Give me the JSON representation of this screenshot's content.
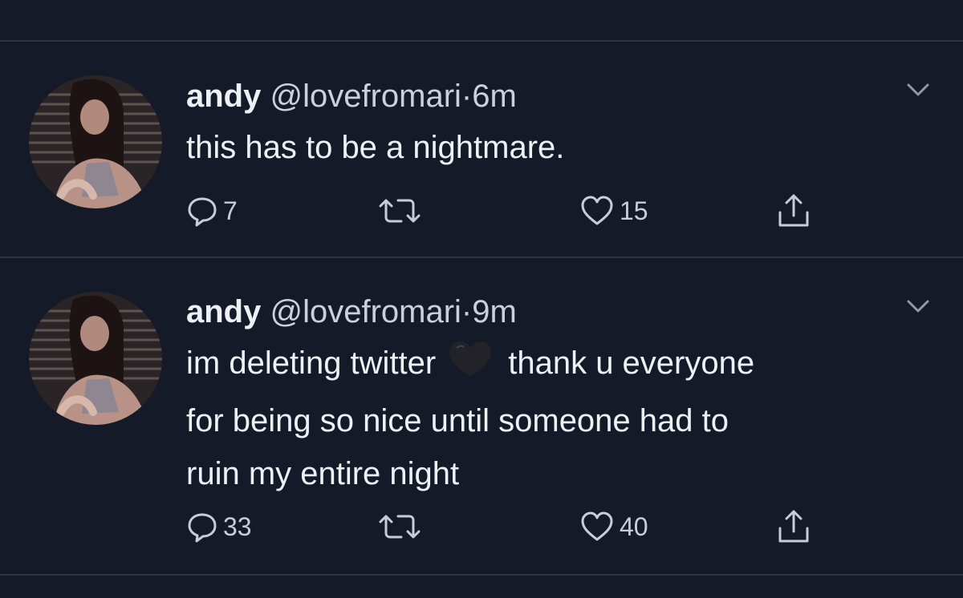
{
  "tweets": [
    {
      "name": "andy",
      "handle": "@lovefromari",
      "separator": "·",
      "time": "6m",
      "text": "this has to be a nightmare.",
      "replies": "7",
      "likes": "15"
    },
    {
      "name": "andy",
      "handle": "@lovefromari",
      "separator": "·",
      "time": "9m",
      "text_before_emoji": "im deleting twitter",
      "emoji": "black-heart",
      "text_after_emoji_line1": "thank u everyone",
      "text_line2": "for being so nice until someone had to",
      "text_line3": "ruin my entire night",
      "replies": "33",
      "likes": "40"
    }
  ],
  "icons": {
    "reply": "reply-bubble-icon",
    "retweet": "retweet-icon",
    "like": "heart-outline-icon",
    "share": "share-icon",
    "menu": "chevron-down-icon"
  },
  "colors": {
    "background": "#141a27",
    "divider": "#2b3444",
    "text": "#eef1f4",
    "secondary_text": "#c9d2db"
  }
}
